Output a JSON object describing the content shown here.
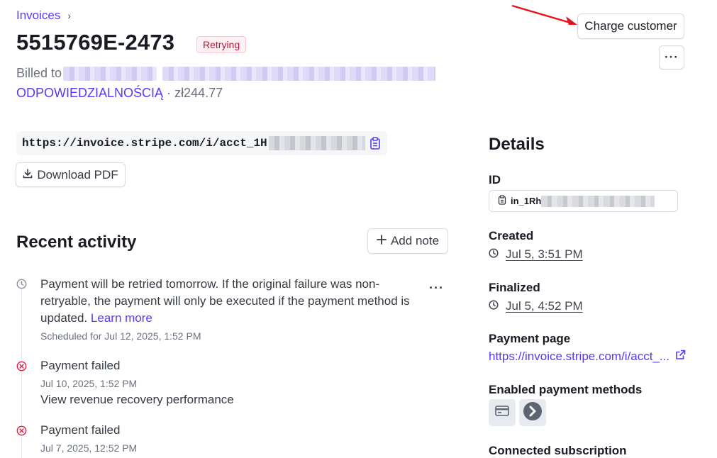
{
  "breadcrumb": {
    "parent": "Invoices",
    "separator": "›"
  },
  "invoice": {
    "number": "5515769E-2473",
    "status": "Retrying",
    "billed_prefix": "Billed to",
    "billed_name_tail": "ODPOWIEDZIALNOŚCIĄ",
    "amount_sep": "·",
    "amount": "zł244.77",
    "url": "https://invoice.stripe.com/i/acct_1H"
  },
  "actions": {
    "charge_customer": "Charge customer",
    "more": "···",
    "download_pdf": "Download PDF",
    "add_note": "Add note"
  },
  "activity": {
    "heading": "Recent activity",
    "more": "···",
    "items": [
      {
        "text_line1": "Payment will be retried tomorrow. If the original failure was non-",
        "text_line2": "retryable, the payment will only be executed if the payment method is",
        "text_line3": "updated.",
        "link": "Learn more",
        "sub": "Scheduled for Jul 12, 2025, 1:52 PM"
      },
      {
        "text": "Payment failed",
        "sub": "Jul 10, 2025, 1:52 PM",
        "link": "View revenue recovery performance"
      },
      {
        "text": "Payment failed",
        "sub": "Jul 7, 2025, 12:52 PM"
      }
    ]
  },
  "details": {
    "heading": "Details",
    "id_label": "ID",
    "id_value": "in_1Rh",
    "created_label": "Created",
    "created_value": "Jul 5, 3:51 PM",
    "finalized_label": "Finalized",
    "finalized_value": "Jul 5, 4:52 PM",
    "payment_page_label": "Payment page",
    "payment_page_value": "https://invoice.stripe.com/i/acct_...",
    "methods_label": "Enabled payment methods",
    "subscription_label": "Connected subscription"
  },
  "colors": {
    "accent": "#533afd",
    "danger": "#df1b41",
    "text": "#353a44"
  }
}
